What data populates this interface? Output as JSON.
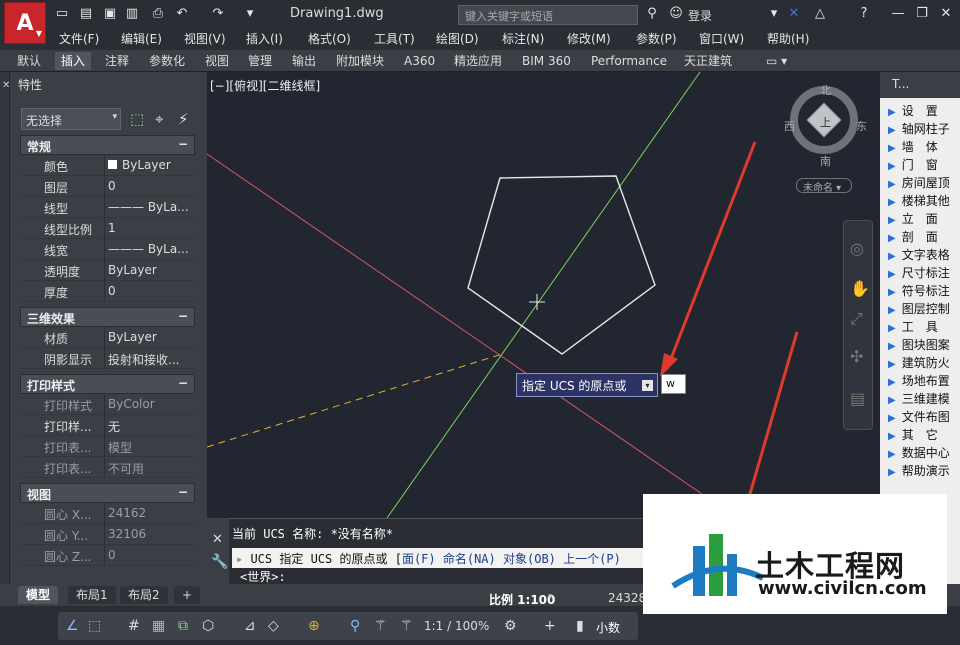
{
  "app": {
    "document_title": "Drawing1.dwg",
    "search_placeholder": "键入关键字或短语",
    "login": "登录",
    "menus": [
      "文件(F)",
      "编辑(E)",
      "视图(V)",
      "插入(I)",
      "格式(O)",
      "工具(T)",
      "绘图(D)",
      "标注(N)",
      "修改(M)",
      "参数(P)",
      "窗口(W)",
      "帮助(H)"
    ],
    "ribbon_tabs": [
      "默认",
      "插入",
      "注释",
      "参数化",
      "视图",
      "管理",
      "输出",
      "附加模块",
      "A360",
      "精选应用",
      "BIM 360",
      "Performance",
      "天正建筑"
    ],
    "active_ribbon_tab": "插入"
  },
  "properties": {
    "title": "特性",
    "selection": "无选择",
    "sections": {
      "general": {
        "title": "常规",
        "rows": [
          {
            "k": "颜色",
            "v": "ByLayer"
          },
          {
            "k": "图层",
            "v": "0"
          },
          {
            "k": "线型",
            "v": "——— ByLa..."
          },
          {
            "k": "线型比例",
            "v": "1"
          },
          {
            "k": "线宽",
            "v": "——— ByLa..."
          },
          {
            "k": "透明度",
            "v": "ByLayer"
          },
          {
            "k": "厚度",
            "v": "0"
          }
        ]
      },
      "effects3d": {
        "title": "三维效果",
        "rows": [
          {
            "k": "材质",
            "v": "ByLayer"
          },
          {
            "k": "阴影显示",
            "v": "投射和接收..."
          }
        ]
      },
      "plot": {
        "title": "打印样式",
        "rows": [
          {
            "k": "打印样式",
            "v": "ByColor"
          },
          {
            "k": "打印样...",
            "v": "无"
          },
          {
            "k": "打印表...",
            "v": "模型"
          },
          {
            "k": "打印表...",
            "v": "不可用"
          }
        ]
      },
      "view": {
        "title": "视图",
        "rows": [
          {
            "k": "圆心 X...",
            "v": "24162"
          },
          {
            "k": "圆心 Y...",
            "v": "32106"
          },
          {
            "k": "圆心 Z...",
            "v": "0"
          }
        ]
      }
    }
  },
  "viewport": {
    "label": "[−][俯视][二维线框]",
    "compass": {
      "n": "北",
      "s": "南",
      "e": "东",
      "w": "西",
      "center": "上"
    },
    "ucs_name": "未命名",
    "tooltip": "指定 UCS 的原点或",
    "input_value": "w"
  },
  "right_panel": {
    "title": "T...",
    "items": [
      "设　置",
      "轴网柱子",
      "墙　体",
      "门　窗",
      "房间屋顶",
      "楼梯其他",
      "立　面",
      "剖　面",
      "文字表格",
      "尺寸标注",
      "符号标注",
      "图层控制",
      "工　具",
      "图块图案",
      "建筑防火",
      "场地布置",
      "三维建模",
      "文件布图",
      "其　它",
      "数据中心",
      "帮助演示"
    ]
  },
  "command": {
    "line1": "当前 UCS 名称: *没有名称*",
    "line2_prompt": "UCS 指定 UCS 的原点或",
    "options": [
      "面(F)",
      "命名(NA)",
      "对象(OB)",
      "上一个(P)"
    ],
    "line3": "<世界>:"
  },
  "layout_tabs": [
    "模型",
    "布局1",
    "布局2"
  ],
  "status": {
    "scale": "比例 1:100",
    "coords": "24328",
    "zoom": "1:1 / 100%",
    "units": "小数"
  },
  "watermark": {
    "name": "土木工程网",
    "url": "www.civilcn.com"
  },
  "colors": {
    "accent": "#c8262b",
    "viewport_bg": "#212630",
    "arrow": "#e03a2c",
    "pentagon": "#e8e8e8",
    "axis_green": "#7cd35a",
    "axis_red": "#d9575f",
    "dashed": "#e0b13a"
  }
}
